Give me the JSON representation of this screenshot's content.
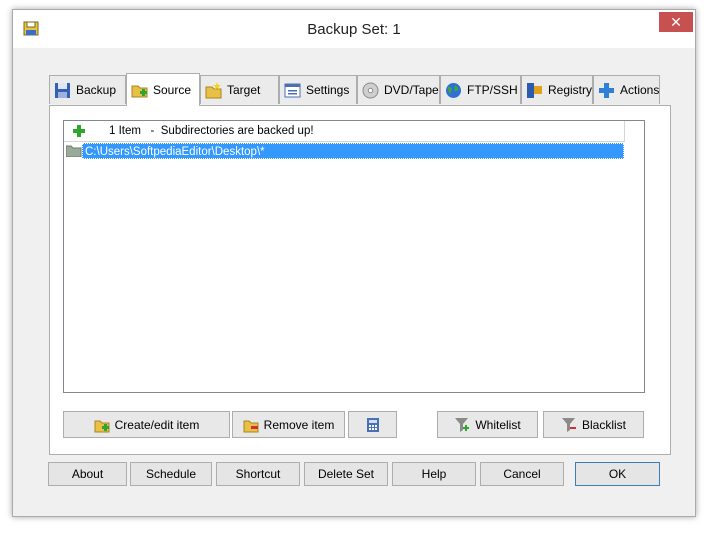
{
  "window": {
    "title": "Backup Set: 1",
    "close_glyph": "✕"
  },
  "tabs": [
    {
      "label": "Backup",
      "icon": "floppy-disk-icon"
    },
    {
      "label": "Source",
      "icon": "folder-add-icon",
      "active": true
    },
    {
      "label": "Target",
      "icon": "folder-star-icon"
    },
    {
      "label": "Settings",
      "icon": "settings-window-icon"
    },
    {
      "label": "DVD/Tape",
      "icon": "disc-icon"
    },
    {
      "label": "FTP/SSH",
      "icon": "globe-icon"
    },
    {
      "label": "Registry",
      "icon": "registry-icon"
    },
    {
      "label": "Actions",
      "icon": "plus-icon"
    }
  ],
  "list": {
    "header": "1 Item   -  Subdirectories are backed up!",
    "items": [
      {
        "path": "C:\\Users\\SoftpediaEditor\\Desktop\\*"
      }
    ]
  },
  "panel_buttons": {
    "create_edit": "Create/edit item",
    "remove": "Remove item",
    "whitelist": "Whitelist",
    "blacklist": "Blacklist"
  },
  "bottom_buttons": {
    "about": "About",
    "schedule": "Schedule",
    "shortcut": "Shortcut",
    "delete_set": "Delete Set",
    "help": "Help",
    "cancel": "Cancel",
    "ok": "OK"
  },
  "colors": {
    "selection": "#3399ff",
    "close": "#c75050",
    "accent_green": "#2fa52f"
  }
}
